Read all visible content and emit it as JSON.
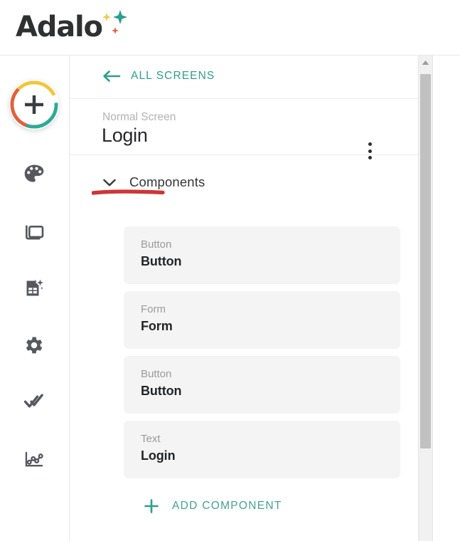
{
  "brand": {
    "logo_text": "Adalo",
    "logo_color": "#2f3031",
    "sparkle_colors": [
      "#f2c94c",
      "#2e9e8f",
      "#e2603f"
    ]
  },
  "rail": {
    "add_button": {
      "name": "add-button",
      "icon": "plus-icon",
      "ring_colors": {
        "teal": "#2eaa97",
        "orange": "#e0613c",
        "yellow": "#f2c63c"
      }
    },
    "items": [
      {
        "icon": "palette-icon",
        "label": "Branding"
      },
      {
        "icon": "screens-icon",
        "label": "Screens"
      },
      {
        "icon": "database-icon",
        "label": "Database"
      },
      {
        "icon": "gear-icon",
        "label": "Settings"
      },
      {
        "icon": "double-check-icon",
        "label": "Publish"
      },
      {
        "icon": "analytics-icon",
        "label": "Analytics"
      }
    ]
  },
  "panel": {
    "back": {
      "label": "ALL SCREENS",
      "icon": "arrow-left-icon",
      "color": "#2e9e8f"
    },
    "screen": {
      "kicker": "Normal Screen",
      "title": "Login",
      "menu_icon": "kebab-menu-icon",
      "annotation_color": "#cf3535"
    },
    "section": {
      "label": "Components",
      "chevron": "chevron-down-icon",
      "expanded": true
    },
    "components": [
      {
        "type": "Button",
        "name": "Button"
      },
      {
        "type": "Form",
        "name": "Form"
      },
      {
        "type": "Button",
        "name": "Button"
      },
      {
        "type": "Text",
        "name": "Login"
      }
    ],
    "add_component": {
      "label": "ADD COMPONENT",
      "icon": "plus-icon",
      "color": "#44a294"
    }
  },
  "scrollbar": {
    "up_arrow_icon": "caret-up-icon",
    "thumb_color": "#c1c1c1",
    "track_color": "#f1f1f1"
  }
}
